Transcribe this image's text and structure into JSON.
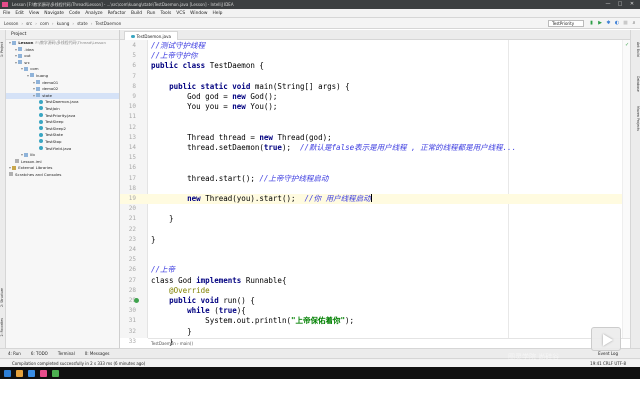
{
  "window": {
    "title": "Lesson [F:\\教学源码\\多线程代码\\Thread\\Lesson] - ...\\src\\com\\kuang\\state\\TestDaemon.java [Lesson] - IntelliJ IDEA",
    "controls": [
      "—",
      "□",
      "✕"
    ]
  },
  "menu": [
    "File",
    "Edit",
    "View",
    "Navigate",
    "Code",
    "Analyze",
    "Refactor",
    "Build",
    "Run",
    "Tools",
    "VCS",
    "Window",
    "Help"
  ],
  "breadcrumbs": [
    "Lesson",
    "src",
    "com",
    "kuang",
    "state",
    "TestDaemon"
  ],
  "run_config": "TestPriority",
  "toolbar_icons": [
    "build-icon",
    "run-icon",
    "debug-icon",
    "coverage-icon",
    "stop-icon",
    "search-icon"
  ],
  "left_tabs": [
    "1: Project",
    "2: Structure",
    "2: Favorites"
  ],
  "project": {
    "header": "Project",
    "tree": [
      {
        "label": "Lesson",
        "note": "F:\\教学源码\\多线程代码\\Thread\\Lesson",
        "depth": 0,
        "icon": "folder",
        "bold": true
      },
      {
        "label": ".idea",
        "depth": 1,
        "icon": "folder"
      },
      {
        "label": "out",
        "depth": 1,
        "icon": "folder"
      },
      {
        "label": "src",
        "depth": 1,
        "icon": "folder"
      },
      {
        "label": "com",
        "depth": 2,
        "icon": "folder"
      },
      {
        "label": "kuang",
        "depth": 3,
        "icon": "folder"
      },
      {
        "label": "demo01",
        "depth": 4,
        "icon": "folder"
      },
      {
        "label": "demo02",
        "depth": 4,
        "icon": "folder"
      },
      {
        "label": "state",
        "depth": 4,
        "icon": "folder",
        "selected": true
      },
      {
        "label": "TestDaemon.java",
        "depth": 5,
        "icon": "java"
      },
      {
        "label": "TestJoin",
        "depth": 5,
        "icon": "java"
      },
      {
        "label": "TestPriority.java",
        "depth": 5,
        "icon": "java"
      },
      {
        "label": "TestSleep",
        "depth": 5,
        "icon": "java"
      },
      {
        "label": "TestSleep2",
        "depth": 5,
        "icon": "java"
      },
      {
        "label": "TestState",
        "depth": 5,
        "icon": "java"
      },
      {
        "label": "TestStop",
        "depth": 5,
        "icon": "java"
      },
      {
        "label": "TestYield.java",
        "depth": 5,
        "icon": "java"
      },
      {
        "label": "lib",
        "depth": 2,
        "icon": "folder"
      },
      {
        "label": "Lesson.iml",
        "depth": 1,
        "icon": "file"
      },
      {
        "label": "External Libraries",
        "depth": 0,
        "icon": "lib"
      },
      {
        "label": "Scratches and Consoles",
        "depth": 0,
        "icon": "file"
      }
    ]
  },
  "editor": {
    "tab": "TestDaemon.java",
    "breadcrumb": "TestDaemon  ›  main()",
    "lines": [
      {
        "n": "4",
        "parts": [
          [
            "cn",
            "//测试守护线程"
          ]
        ]
      },
      {
        "n": "5",
        "parts": [
          [
            "cn",
            "//上帝守护你"
          ]
        ]
      },
      {
        "n": "6",
        "parts": [
          [
            "kw",
            "public class "
          ],
          [
            "",
            "TestDaemon {"
          ]
        ]
      },
      {
        "n": "7",
        "parts": []
      },
      {
        "n": "8",
        "parts": [
          [
            "",
            "    "
          ],
          [
            "kw",
            "public static void "
          ],
          [
            "",
            "main(String[] args) {"
          ]
        ]
      },
      {
        "n": "9",
        "parts": [
          [
            "",
            "        God god = "
          ],
          [
            "kw",
            "new "
          ],
          [
            "",
            "God();"
          ]
        ]
      },
      {
        "n": "10",
        "parts": [
          [
            "",
            "        You you = "
          ],
          [
            "kw",
            "new "
          ],
          [
            "",
            "You();"
          ]
        ]
      },
      {
        "n": "11",
        "parts": []
      },
      {
        "n": "12",
        "parts": []
      },
      {
        "n": "13",
        "parts": [
          [
            "",
            "        Thread thread = "
          ],
          [
            "kw",
            "new "
          ],
          [
            "",
            "Thread(god);"
          ]
        ]
      },
      {
        "n": "14",
        "parts": [
          [
            "",
            "        thread.setDaemon("
          ],
          [
            "kw",
            "true"
          ],
          [
            "",
            ");  "
          ],
          [
            "cn",
            "//默认是false表示是用户线程 , 正常的线程都是用户线程..."
          ]
        ]
      },
      {
        "n": "15",
        "parts": []
      },
      {
        "n": "16",
        "parts": []
      },
      {
        "n": "17",
        "parts": [
          [
            "",
            "        thread.start(); "
          ],
          [
            "cn",
            "//上帝守护线程启动"
          ]
        ]
      },
      {
        "n": "18",
        "parts": []
      },
      {
        "n": "19",
        "parts": [
          [
            "",
            "        "
          ],
          [
            "kw",
            "new "
          ],
          [
            "",
            "Thread(you).start();  "
          ],
          [
            "cn",
            "//你 用户线程启动"
          ]
        ],
        "current": true
      },
      {
        "n": "20",
        "parts": []
      },
      {
        "n": "21",
        "parts": [
          [
            "",
            "    }"
          ]
        ]
      },
      {
        "n": "22",
        "parts": []
      },
      {
        "n": "23",
        "parts": [
          [
            "",
            "}"
          ]
        ]
      },
      {
        "n": "24",
        "parts": []
      },
      {
        "n": "25",
        "parts": []
      },
      {
        "n": "26",
        "parts": [
          [
            "cn",
            "//上帝"
          ]
        ]
      },
      {
        "n": "27",
        "parts": [
          [
            "",
            "class "
          ],
          [
            "",
            "God "
          ],
          [
            "kw",
            "implements "
          ],
          [
            "",
            "Runnable{"
          ]
        ]
      },
      {
        "n": "28",
        "parts": [
          [
            "ann",
            "    @Override"
          ]
        ]
      },
      {
        "n": "29",
        "parts": [
          [
            "",
            "    "
          ],
          [
            "kw",
            "public void "
          ],
          [
            "",
            "run() {"
          ]
        ],
        "marker": true
      },
      {
        "n": "30",
        "parts": [
          [
            "",
            "        "
          ],
          [
            "kw",
            "while "
          ],
          [
            "",
            "("
          ],
          [
            "kw",
            "true"
          ],
          [
            "",
            "){"
          ]
        ]
      },
      {
        "n": "31",
        "parts": [
          [
            "",
            "            System.out.println("
          ],
          [
            "str",
            "\"上帝保佑着你\""
          ],
          [
            "",
            ");"
          ]
        ]
      },
      {
        "n": "32",
        "parts": [
          [
            "",
            "        }"
          ]
        ]
      },
      {
        "n": "33",
        "parts": [
          [
            "",
            "    }"
          ]
        ]
      }
    ]
  },
  "right_tabs": [
    "Ant Build",
    "Database",
    "Maven Projects"
  ],
  "bottom_tabs": [
    "4: Run",
    "6: TODO",
    "Terminal",
    "0: Messages"
  ],
  "event_log": "Event Log",
  "status": {
    "message": "Compilation completed successfully in 2 s 333 ms (6 minutes ago)",
    "position": "19:41  CRLF  UTF-8"
  },
  "watermark": "图灵学院 尚硅谷"
}
